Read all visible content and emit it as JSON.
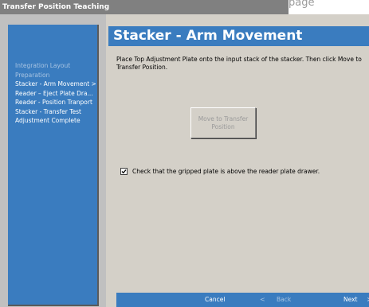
{
  "window": {
    "title": "Transfer Position Teaching",
    "title_overflow_text": "page"
  },
  "sidebar": {
    "items": [
      {
        "label": "Integration Layout",
        "state": "done"
      },
      {
        "label": "Preparation",
        "state": "done"
      },
      {
        "label": "Stacker - Arm Movement  >",
        "state": "active"
      },
      {
        "label": "Reader – Eject Plate Dra...",
        "state": "pending"
      },
      {
        "label": "Reader - Position Tranport",
        "state": "pending"
      },
      {
        "label": "Stacker - Transfer Test",
        "state": "pending"
      },
      {
        "label": "Adjustment Complete",
        "state": "pending"
      }
    ]
  },
  "main": {
    "header": "Stacker - Arm Movement",
    "instructions": "Place Top Adjustment Plate onto the input stack of the stacker. Then click Move to Transfer Position.",
    "move_button_line1": "Move to Transfer",
    "move_button_line2": "Position",
    "checkbox_label": "Check that the gripped plate is above the reader plate drawer.",
    "checkbox_checked": true
  },
  "footer": {
    "cancel_label": "Cancel",
    "back_label": "Back",
    "next_label": "Next",
    "back_chevron": "<",
    "next_chevron": ">"
  },
  "colors": {
    "accent": "#3a7cbf",
    "title_bar": "#808080",
    "background": "#d4d0c8"
  }
}
